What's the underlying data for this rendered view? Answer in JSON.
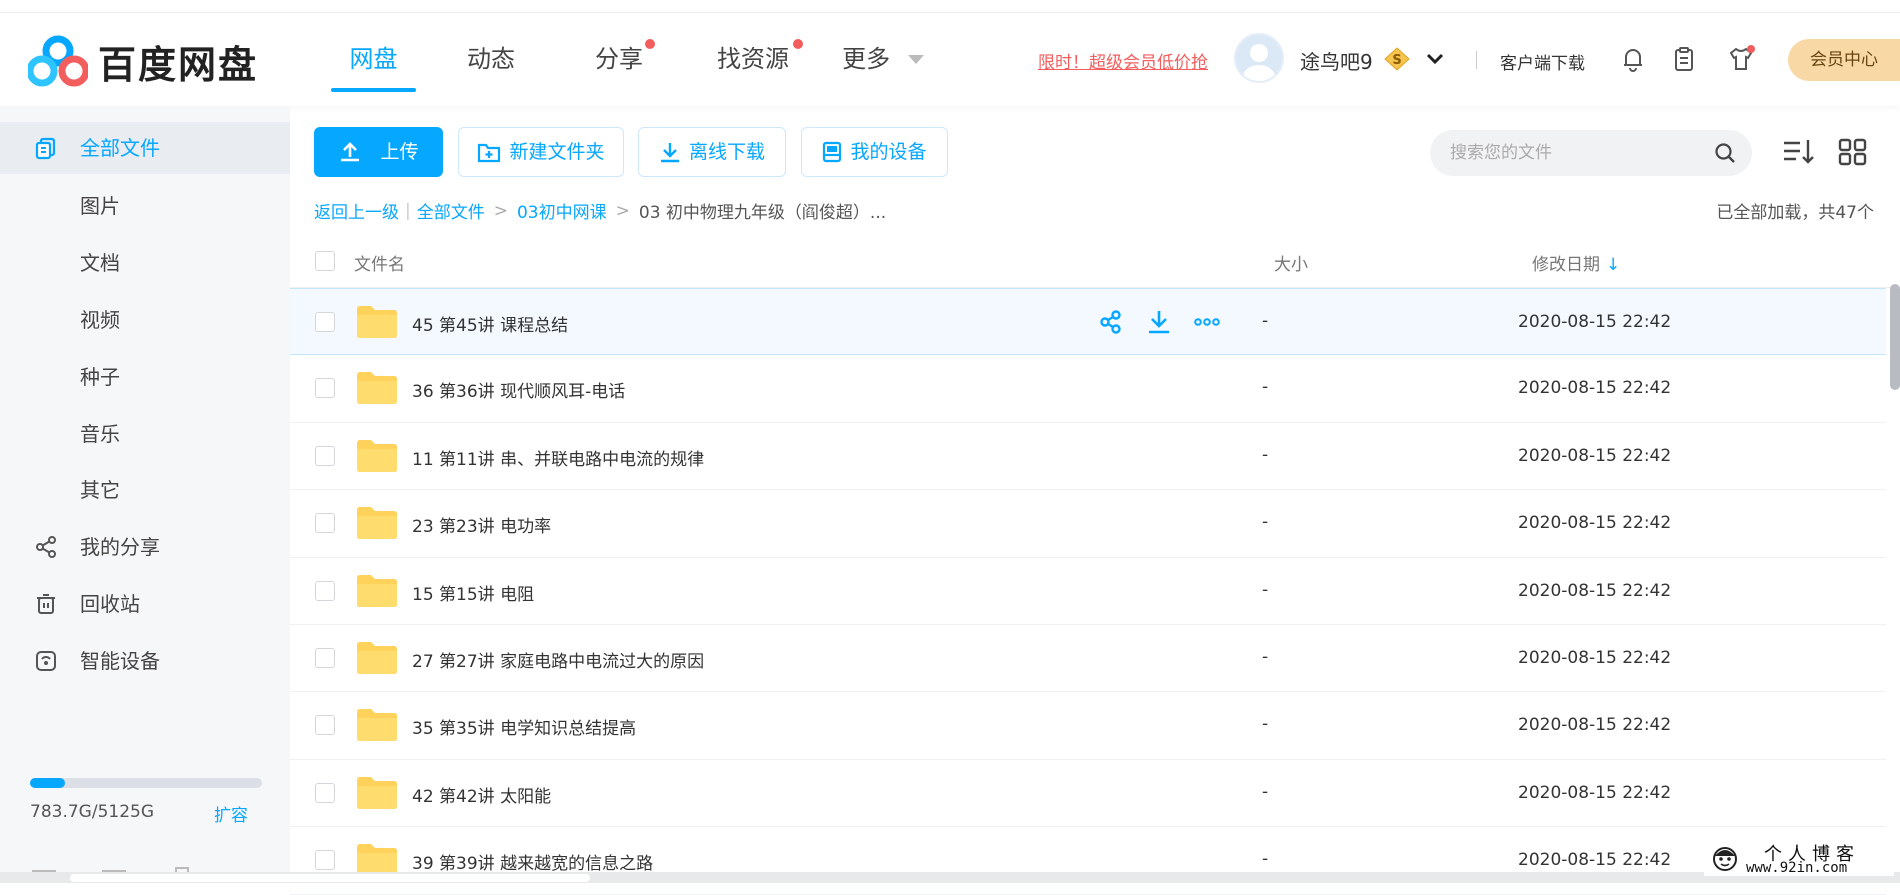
{
  "brand": {
    "name": "百度网盘",
    "accent": "#06a7ff"
  },
  "nav": {
    "items": [
      {
        "label": "网盘",
        "active": true
      },
      {
        "label": "动态"
      },
      {
        "label": "分享",
        "dot": true
      },
      {
        "label": "找资源",
        "dot": true
      },
      {
        "label": "更多",
        "dropdown": true
      }
    ]
  },
  "header": {
    "promo": "限时！超级会员低价抢",
    "username": "途鸟吧9",
    "client_download": "客户端下载",
    "member_center": "会员中心"
  },
  "sidebar": {
    "items": [
      {
        "label": "全部文件",
        "icon": "all-files-icon",
        "active": true
      },
      {
        "label": "图片"
      },
      {
        "label": "文档"
      },
      {
        "label": "视频"
      },
      {
        "label": "种子"
      },
      {
        "label": "音乐"
      },
      {
        "label": "其它"
      },
      {
        "label": "我的分享",
        "icon": "share-icon"
      },
      {
        "label": "回收站",
        "icon": "trash-icon"
      },
      {
        "label": "智能设备",
        "icon": "device-icon"
      }
    ],
    "storage": {
      "used_text": "783.7G/5125G",
      "used_fraction": 0.153,
      "expand": "扩容"
    }
  },
  "toolbar": {
    "upload": "上传",
    "new_folder": "新建文件夹",
    "offline_download": "离线下载",
    "my_devices": "我的设备",
    "search_placeholder": "搜索您的文件"
  },
  "breadcrumb": {
    "back": "返回上一级",
    "all_files": "全部文件",
    "level1": "03初中网课",
    "current": "03 初中物理九年级（阎俊超）..."
  },
  "status": {
    "loaded": "已全部加载，共47个"
  },
  "table": {
    "headers": {
      "name": "文件名",
      "size": "大小",
      "date": "修改日期"
    },
    "rows": [
      {
        "name": "45 第45讲 课程总结",
        "size": "-",
        "date": "2020-08-15 22:42",
        "hover": true
      },
      {
        "name": "36 第36讲 现代顺风耳-电话",
        "size": "-",
        "date": "2020-08-15 22:42"
      },
      {
        "name": "11 第11讲 串、并联电路中电流的规律",
        "size": "-",
        "date": "2020-08-15 22:42"
      },
      {
        "name": "23 第23讲 电功率",
        "size": "-",
        "date": "2020-08-15 22:42"
      },
      {
        "name": "15 第15讲 电阻",
        "size": "-",
        "date": "2020-08-15 22:42"
      },
      {
        "name": "27 第27讲 家庭电路中电流过大的原因",
        "size": "-",
        "date": "2020-08-15 22:42"
      },
      {
        "name": "35 第35讲 电学知识总结提高",
        "size": "-",
        "date": "2020-08-15 22:42"
      },
      {
        "name": "42 第42讲 太阳能",
        "size": "-",
        "date": "2020-08-15 22:42"
      },
      {
        "name": "39 第39讲 越来越宽的信息之路",
        "size": "-",
        "date": "2020-08-15 22:42"
      }
    ]
  },
  "watermark": {
    "line1": "个人博客",
    "line2": "www.92in.com"
  }
}
